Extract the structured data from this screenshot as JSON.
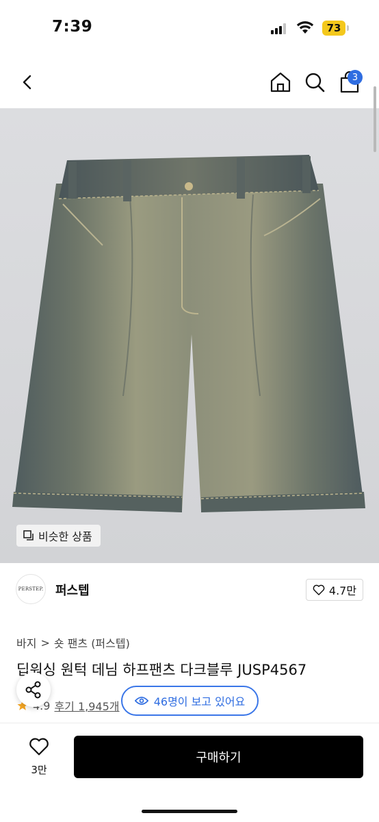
{
  "status_bar": {
    "time": "7:39",
    "battery": "73"
  },
  "nav": {
    "cart_count": "3",
    "icons": [
      "back-icon",
      "home-icon",
      "search-icon",
      "cart-icon"
    ]
  },
  "hero": {
    "similar_label": "비슷한 상품",
    "image": "denim-shorts-photo"
  },
  "brand": {
    "logo_text": "PERSTEP.",
    "name": "퍼스텝",
    "likes": "4.7만"
  },
  "product": {
    "category": [
      "바지",
      ">",
      "숏 팬츠 (퍼스텝)"
    ],
    "title": "딥워싱 원턱 데님 하프팬츠 다크블루 JUSP4567",
    "rating": "4.9",
    "reviews": "후기 1,945개"
  },
  "viewers": {
    "label": "46명이 보고 있어요"
  },
  "bottom": {
    "fav_count": "3만",
    "buy_label": "구매하기"
  },
  "colors": {
    "accent": "#2f6de1",
    "battery": "#f4c81c",
    "buy": "#000000",
    "star": "#f5a623"
  }
}
